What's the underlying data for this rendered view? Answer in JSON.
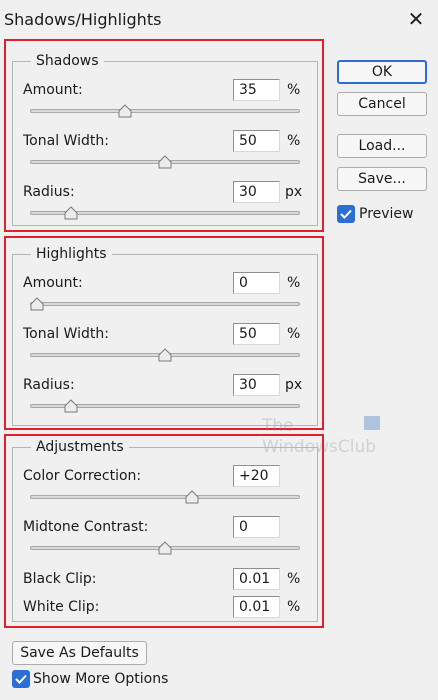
{
  "window": {
    "title": "Shadows/Highlights",
    "close_glyph": "✕"
  },
  "shadows": {
    "legend": "Shadows",
    "amount": {
      "label": "Amount:",
      "value": "35",
      "unit": "%",
      "slider_fraction": 0.35
    },
    "tonal_width": {
      "label": "Tonal Width:",
      "value": "50",
      "unit": "%",
      "slider_fraction": 0.5
    },
    "radius": {
      "label": "Radius:",
      "value": "30",
      "unit": "px",
      "slider_fraction": 0.15
    }
  },
  "highlights": {
    "legend": "Highlights",
    "amount": {
      "label": "Amount:",
      "value": "0",
      "unit": "%",
      "slider_fraction": 0.0
    },
    "tonal_width": {
      "label": "Tonal Width:",
      "value": "50",
      "unit": "%",
      "slider_fraction": 0.5
    },
    "radius": {
      "label": "Radius:",
      "value": "30",
      "unit": "px",
      "slider_fraction": 0.15
    }
  },
  "adjustments": {
    "legend": "Adjustments",
    "color_correction": {
      "label": "Color Correction:",
      "value": "+20",
      "slider_fraction": 0.6
    },
    "midtone_contrast": {
      "label": "Midtone Contrast:",
      "value": "0",
      "slider_fraction": 0.5
    },
    "black_clip": {
      "label": "Black Clip:",
      "value": "0.01",
      "unit": "%"
    },
    "white_clip": {
      "label": "White Clip:",
      "value": "0.01",
      "unit": "%"
    }
  },
  "buttons": {
    "ok": "OK",
    "cancel": "Cancel",
    "load": "Load...",
    "save": "Save...",
    "save_defaults": "Save As Defaults"
  },
  "checkboxes": {
    "preview": {
      "label": "Preview",
      "checked": true
    },
    "show_more": {
      "label": "Show More Options",
      "checked": true
    }
  },
  "watermark": {
    "line1": "The",
    "line2": "WindowsClub"
  },
  "colors": {
    "highlight_box": "#e0202a",
    "accent": "#2b6fd6"
  }
}
